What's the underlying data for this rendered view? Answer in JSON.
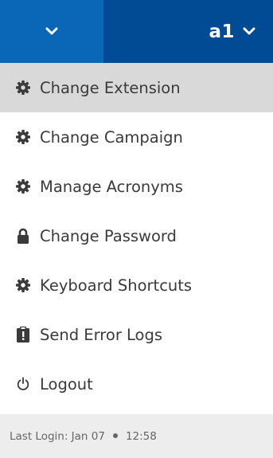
{
  "header": {
    "user": "a1",
    "colors": {
      "left": "#0a66b6",
      "right": "#004b93"
    }
  },
  "menu": {
    "items": [
      {
        "label": "Change Extension",
        "icon": "gear-icon",
        "active": true
      },
      {
        "label": "Change Campaign",
        "icon": "gear-icon",
        "active": false
      },
      {
        "label": "Manage Acronyms",
        "icon": "gear-icon",
        "active": false
      },
      {
        "label": "Change Password",
        "icon": "lock-icon",
        "active": false
      },
      {
        "label": "Keyboard Shortcuts",
        "icon": "gear-icon",
        "active": false
      },
      {
        "label": "Send Error Logs",
        "icon": "clipboard-icon",
        "active": false
      },
      {
        "label": "Logout",
        "icon": "power-icon",
        "active": false
      }
    ]
  },
  "footer": {
    "last_login_label": "Last Login: Jan 07",
    "time": "12:58"
  }
}
